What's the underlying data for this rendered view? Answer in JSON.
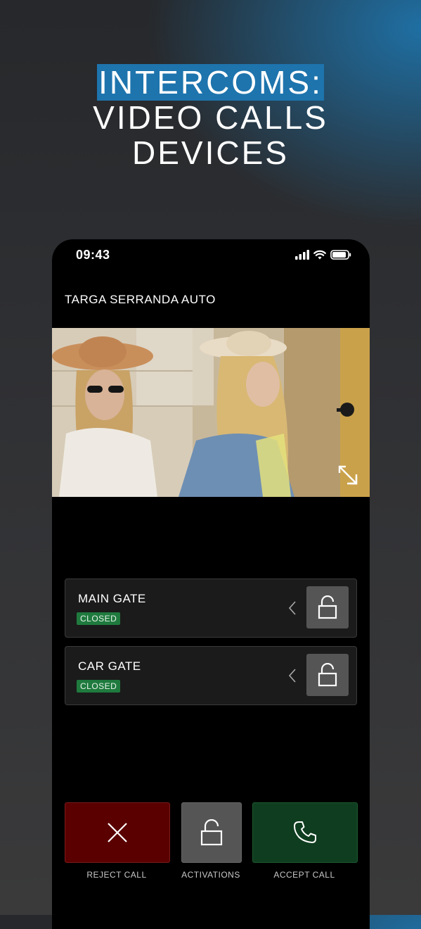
{
  "hero": {
    "line1": "INTERCOMS:",
    "line2": "VIDEO CALLS",
    "line3": "DEVICES"
  },
  "status_bar": {
    "time": "09:43",
    "icons": [
      "signal-icon",
      "wifi-icon",
      "battery-icon"
    ]
  },
  "device": {
    "name": "TARGA SERRANDA AUTO"
  },
  "gates": [
    {
      "title": "MAIN GATE",
      "status": "CLOSED"
    },
    {
      "title": "CAR GATE",
      "status": "CLOSED"
    }
  ],
  "actions": {
    "reject_label": "REJECT CALL",
    "activations_label": "ACTIVATIONS",
    "accept_label": "ACCEPT CALL"
  },
  "colors": {
    "accent_blue": "#1e74ad",
    "closed_badge": "#1f7a3e",
    "reject": "#5a0000",
    "accept": "#0f3d1f",
    "neutral_button": "#555555"
  }
}
